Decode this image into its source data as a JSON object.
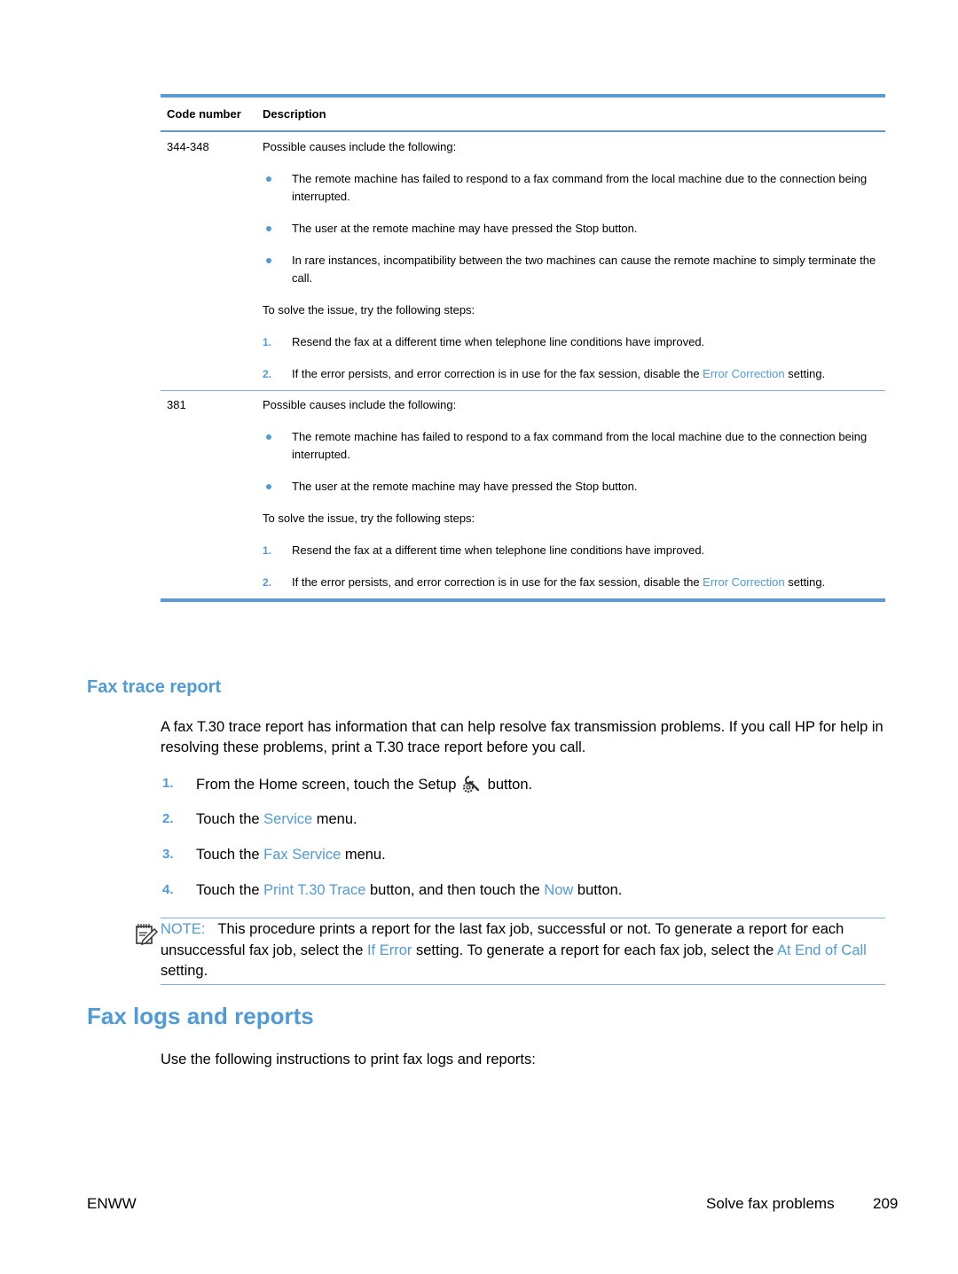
{
  "table": {
    "headers": {
      "code": "Code number",
      "description": "Description"
    },
    "rows": [
      {
        "code": "344-348",
        "intro": "Possible causes include the following:",
        "causes": [
          "The remote machine has failed to respond to a fax command from the local machine due to the connection being interrupted.",
          "The user at the remote machine may have pressed the Stop button.",
          "In rare instances, incompatibility between the two machines can cause the remote machine to simply terminate the call."
        ],
        "steps_intro": "To solve the issue, try the following steps:",
        "steps": [
          {
            "num": "1.",
            "text": "Resend the fax at a different time when telephone line conditions have improved."
          },
          {
            "num": "2.",
            "text_before": "If the error persists, and error correction is in use for the fax session, disable the ",
            "link": "Error Correction",
            "text_after": " setting."
          }
        ]
      },
      {
        "code": "381",
        "intro": "Possible causes include the following:",
        "causes": [
          "The remote machine has failed to respond to a fax command from the local machine due to the connection being interrupted.",
          "The user at the remote machine may have pressed the Stop button."
        ],
        "steps_intro": "To solve the issue, try the following steps:",
        "steps": [
          {
            "num": "1.",
            "text": "Resend the fax at a different time when telephone line conditions have improved."
          },
          {
            "num": "2.",
            "text_before": "If the error persists, and error correction is in use for the fax session, disable the ",
            "link": "Error Correction",
            "text_after": " setting."
          }
        ]
      }
    ]
  },
  "fax_trace": {
    "heading": "Fax trace report",
    "paragraph": "A fax T.30 trace report has information that can help resolve fax transmission problems. If you call HP for help in resolving these problems, print a T.30 trace report before you call.",
    "steps": [
      {
        "num": "1.",
        "before": "From the Home screen, touch the Setup",
        "icon": "setup-wrench-gear-icon",
        "after": " button."
      },
      {
        "num": "2.",
        "before": "Touch the ",
        "link": "Service",
        "after": " menu."
      },
      {
        "num": "3.",
        "before": "Touch the ",
        "link": "Fax Service",
        "after": " menu."
      },
      {
        "num": "4.",
        "before": "Touch the ",
        "link": "Print T.30 Trace",
        "middle": " button, and then touch the ",
        "link2": "Now",
        "after": " button."
      }
    ],
    "note": {
      "label": "NOTE:",
      "t1": "This procedure prints a report for the last fax job, successful or not. To generate a report for each unsuccessful fax job, select the ",
      "link1": "If Error",
      "t2": " setting. To generate a report for each fax job, select the ",
      "link2": "At End of Call",
      "t3": " setting."
    }
  },
  "fax_logs": {
    "heading": "Fax logs and reports",
    "paragraph": "Use the following instructions to print fax logs and reports:"
  },
  "footer": {
    "left": "ENWW",
    "section": "Solve fax problems",
    "page": "209"
  },
  "colors": {
    "accent": "#4f9bd6",
    "rule": "#5b9bd5"
  }
}
